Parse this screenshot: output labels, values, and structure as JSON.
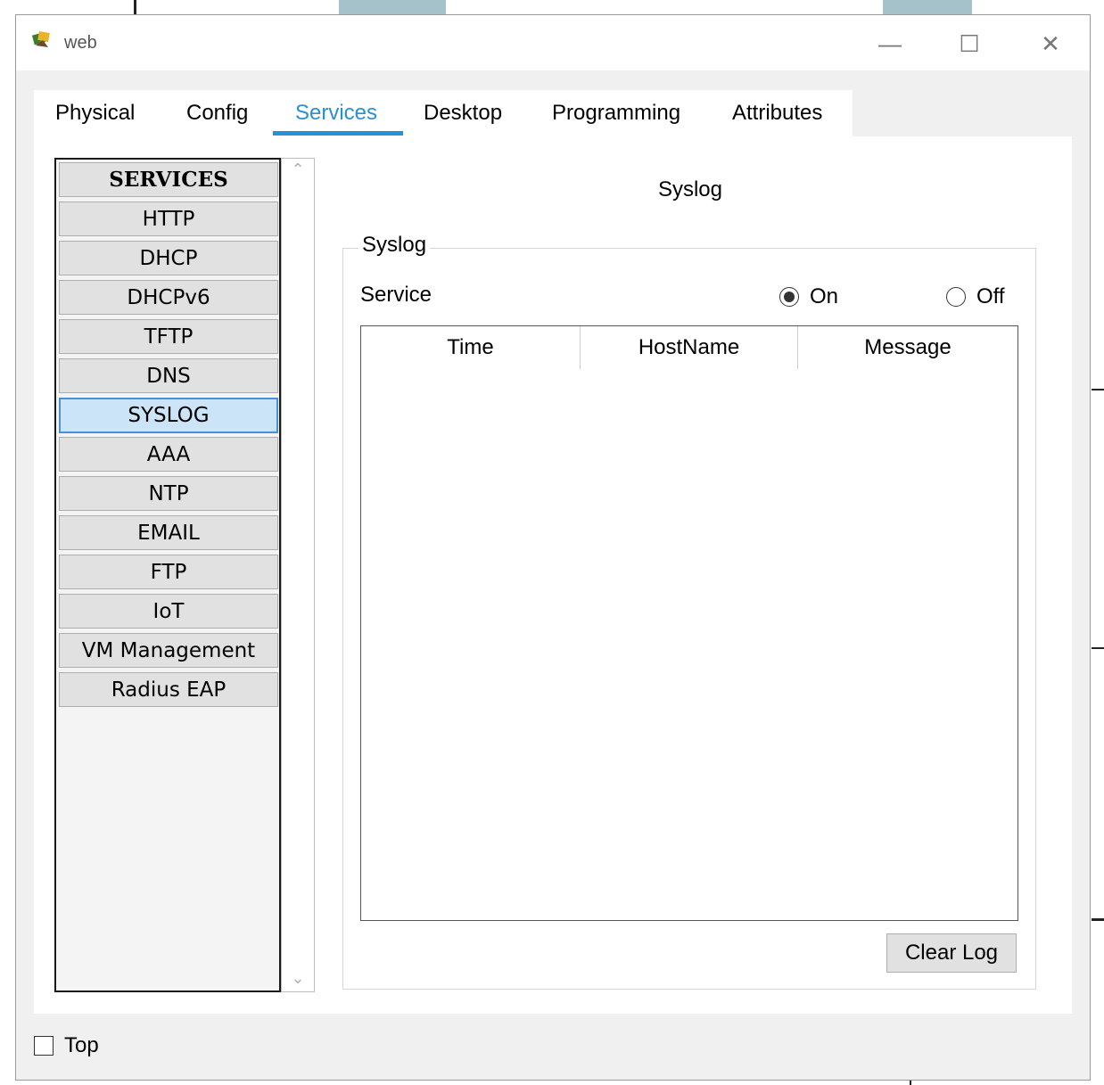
{
  "window": {
    "title": "web",
    "icon": "packet-tracer-device-icon"
  },
  "controls": {
    "minimize": "—",
    "maximize": "☐",
    "close": "✕"
  },
  "tabs": [
    {
      "label": "Physical"
    },
    {
      "label": "Config"
    },
    {
      "label": "Services",
      "active": true
    },
    {
      "label": "Desktop"
    },
    {
      "label": "Programming"
    },
    {
      "label": "Attributes"
    }
  ],
  "services": {
    "header": "SERVICES",
    "items": [
      "HTTP",
      "DHCP",
      "DHCPv6",
      "TFTP",
      "DNS",
      "SYSLOG",
      "AAA",
      "NTP",
      "EMAIL",
      "FTP",
      "IoT",
      "VM Management",
      "Radius EAP"
    ],
    "selected": "SYSLOG"
  },
  "panel": {
    "title": "Syslog",
    "group_label": "Syslog",
    "service_label": "Service",
    "on_label": "On",
    "off_label": "Off",
    "service_state": "On",
    "columns": [
      "Time",
      "HostName",
      "Message"
    ],
    "rows": [],
    "clear_button": "Clear Log"
  },
  "footer": {
    "top_label": "Top",
    "top_checked": false
  },
  "colors": {
    "accent": "#2b8fd6",
    "selected_bg": "#cce4f7"
  }
}
